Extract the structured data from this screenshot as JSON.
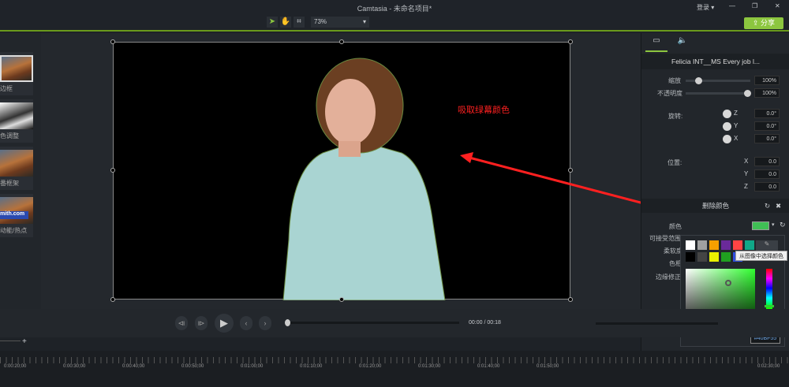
{
  "window": {
    "title": "Camtasia - 未命名项目*",
    "login": "登录 ▾",
    "minimize": "—",
    "restore": "❐",
    "close": "✕"
  },
  "toolbar": {
    "select": "➤",
    "pan": "✋",
    "crop": "⌗",
    "zoom": "73%",
    "zoom_arrow": "▾",
    "share": "分享",
    "share_icon": "⇪"
  },
  "left_panel": {
    "items": [
      {
        "label": "边框"
      },
      {
        "label": "色调整"
      },
      {
        "label": "番框架"
      },
      {
        "label": "动能/热点",
        "overlay": "mith.com"
      }
    ]
  },
  "annotation": {
    "text": "吸取绿幕颜色",
    "color": "#ff2020"
  },
  "properties": {
    "clip_name": "Felicia INT__MS Every job l...",
    "scale_label": "缩放",
    "scale_value": "100%",
    "opacity_label": "不透明度",
    "opacity_value": "100%",
    "rotation_label": "旋转:",
    "rotation": [
      {
        "axis": "Z",
        "value": "0.0°"
      },
      {
        "axis": "Y",
        "value": "0.0°"
      },
      {
        "axis": "X",
        "value": "0.0°"
      }
    ],
    "position_label": "位置:",
    "position": [
      {
        "axis": "X",
        "value": "0.0"
      },
      {
        "axis": "Y",
        "value": "0.0"
      },
      {
        "axis": "Z",
        "value": "0.0"
      }
    ]
  },
  "remove_color": {
    "title": "删除颜色",
    "reset": "↻",
    "close": "✖",
    "labels": [
      "颜色",
      "可接受范围",
      "柔软度",
      "色相",
      "边缘修正"
    ],
    "color_value": "#40BF55",
    "tooltip": "从图像中选择颜色",
    "swatches": [
      "#ffffff",
      "#a0a0a0",
      "#f5a000",
      "#6a2a9a",
      "#ff4444",
      "#10a888",
      "#000000",
      "#444444",
      "#e8f000",
      "#20a020",
      "#3050e0"
    ]
  },
  "playback": {
    "current": "00:00",
    "separator": "/",
    "total": "00:18",
    "buttons": [
      "⧏",
      "⧐",
      "▶",
      "‹",
      "›"
    ]
  },
  "timeline": {
    "add": "+",
    "ticks": [
      "0:00:20;00",
      "0:00:30;00",
      "0:00:40;00",
      "0:00:50;00",
      "0:01:00;00",
      "0:01:10;00",
      "0:01:20;00",
      "0:01:30;00",
      "0:01:40;00",
      "0:01:50;00",
      "0:02:30;00"
    ]
  }
}
